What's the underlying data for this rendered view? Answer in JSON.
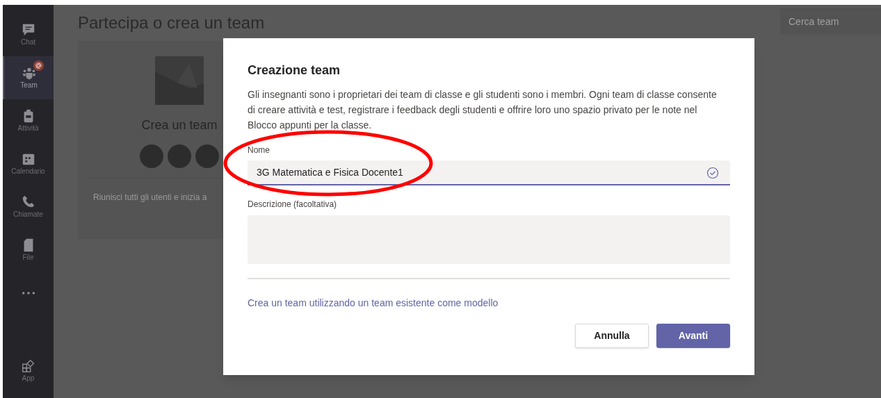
{
  "rail": {
    "items": [
      {
        "kind": "chat",
        "label": "Chat",
        "selected": false
      },
      {
        "kind": "team",
        "label": "Team",
        "selected": true,
        "badge": true
      },
      {
        "kind": "activity",
        "label": "Attività",
        "selected": false
      },
      {
        "kind": "calendar",
        "label": "Calendario",
        "selected": false
      },
      {
        "kind": "calls",
        "label": "Chiamate",
        "selected": false
      },
      {
        "kind": "file",
        "label": "File",
        "selected": false
      },
      {
        "kind": "more",
        "selected": false
      }
    ],
    "bottom": {
      "kind": "apps",
      "label": "App"
    }
  },
  "page": {
    "title": "Partecipa o crea un team",
    "search": {
      "placeholder": "Cerca team"
    },
    "card": {
      "title": "Crea un team",
      "text": "Riunisci tutti gli utenti e inizia a"
    }
  },
  "dialog": {
    "title": "Creazione team",
    "description": "Gli insegnanti sono i proprietari dei team di classe e gli studenti sono i membri. Ogni team di classe consente di creare attività e test, registrare i feedback degli studenti e offrire loro uno spazio privato per le note nel Blocco appunti per la classe.",
    "name_field": {
      "label": "Nome",
      "value": "3G Matematica e Fisica Docente1",
      "valid": true
    },
    "description_field": {
      "label": "Descrizione (facoltativa)"
    },
    "template_link": "Crea un team utilizzando un team esistente come modello",
    "buttons": [
      {
        "kind": "secondary",
        "label": "Annulla"
      },
      {
        "kind": "primary",
        "label": "Avanti"
      }
    ]
  },
  "annotation": {
    "highlight_name_field": true
  }
}
